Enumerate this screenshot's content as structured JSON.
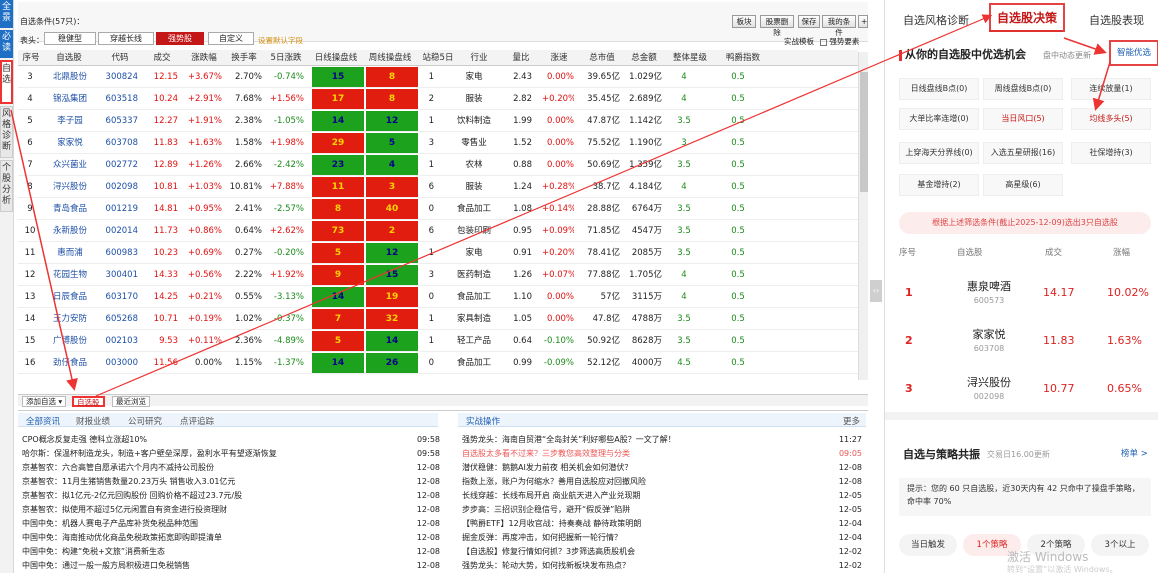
{
  "sidebar": [
    "全景",
    "必读",
    "自选",
    "风格诊断",
    "个股分析"
  ],
  "cond": {
    "title": "自选条件(57只)：",
    "label": "表头：",
    "tabs": [
      "稳健型",
      "穿越长线",
      "强势股",
      "自定义"
    ],
    "custom_link": "设置默认字段",
    "right_buttons": [
      "板块",
      "股票删除",
      "保存",
      "我的条件",
      "+"
    ],
    "realtime": "实战模板",
    "follow": "强势要素"
  },
  "columns": [
    "序号",
    "自选股",
    "代码",
    "成交",
    "涨跌幅",
    "换手率",
    "5日涨跌",
    "日线操盘线",
    "周线操盘线",
    "站稳5日",
    "行业",
    "量比",
    "涨速",
    "总市值",
    "总金额",
    "整体星级",
    "鸭爵指数"
  ],
  "rows": [
    {
      "n": "3",
      "name": "北鼎股份",
      "code": "300824",
      "p": "12.15",
      "chg": "+3.67%",
      "turn": "2.70%",
      "d5": "-0.74%",
      "day": "15",
      "week": "8",
      "dc": "g",
      "wc": "r",
      "st": "1",
      "ind": "家电",
      "vr": "2.43",
      "spd": "0.00%",
      "mv": "39.65亿",
      "amt": "1.029亿",
      "star": "4",
      "idx": "0.5"
    },
    {
      "n": "4",
      "name": "锦泓集团",
      "code": "603518",
      "p": "10.24",
      "chg": "+2.91%",
      "turn": "7.68%",
      "d5": "+1.56%",
      "day": "17",
      "week": "8",
      "dc": "r",
      "wc": "r",
      "st": "2",
      "ind": "服装",
      "vr": "2.82",
      "spd": "+0.20%",
      "mv": "35.45亿",
      "amt": "2.689亿",
      "star": "4",
      "idx": "0.5"
    },
    {
      "n": "5",
      "name": "李子园",
      "code": "605337",
      "p": "12.27",
      "chg": "+1.91%",
      "turn": "2.38%",
      "d5": "-1.05%",
      "day": "14",
      "week": "12",
      "dc": "g",
      "wc": "g",
      "st": "1",
      "ind": "饮料制造",
      "vr": "1.99",
      "spd": "0.00%",
      "mv": "47.87亿",
      "amt": "1.142亿",
      "star": "3.5",
      "idx": "0.5"
    },
    {
      "n": "6",
      "name": "家家悦",
      "code": "603708",
      "p": "11.83",
      "chg": "+1.63%",
      "turn": "1.58%",
      "d5": "+1.98%",
      "day": "29",
      "week": "5",
      "dc": "r",
      "wc": "g",
      "st": "3",
      "ind": "零售业",
      "vr": "1.52",
      "spd": "0.00%",
      "mv": "75.52亿",
      "amt": "1.190亿",
      "star": "3",
      "idx": "0.5"
    },
    {
      "n": "7",
      "name": "众兴菌业",
      "code": "002772",
      "p": "12.89",
      "chg": "+1.26%",
      "turn": "2.66%",
      "d5": "-2.42%",
      "day": "23",
      "week": "4",
      "dc": "g",
      "wc": "g",
      "st": "1",
      "ind": "农林",
      "vr": "0.88",
      "spd": "0.00%",
      "mv": "50.69亿",
      "amt": "1.359亿",
      "star": "3.5",
      "idx": "0.5"
    },
    {
      "n": "8",
      "name": "浔兴股份",
      "code": "002098",
      "p": "10.81",
      "chg": "+1.03%",
      "turn": "10.81%",
      "d5": "+7.88%",
      "day": "11",
      "week": "3",
      "dc": "r",
      "wc": "r",
      "st": "6",
      "ind": "服装",
      "vr": "1.24",
      "spd": "+0.28%",
      "mv": "38.7亿",
      "amt": "4.184亿",
      "star": "4",
      "idx": "0.5"
    },
    {
      "n": "9",
      "name": "青岛食品",
      "code": "001219",
      "p": "14.81",
      "chg": "+0.95%",
      "turn": "2.41%",
      "d5": "-2.57%",
      "day": "8",
      "week": "40",
      "dc": "r",
      "wc": "r",
      "st": "0",
      "ind": "食品加工",
      "vr": "1.08",
      "spd": "+0.14%",
      "mv": "28.88亿",
      "amt": "6764万",
      "star": "3.5",
      "idx": "0.5"
    },
    {
      "n": "10",
      "name": "永新股份",
      "code": "002014",
      "p": "11.73",
      "chg": "+0.86%",
      "turn": "0.64%",
      "d5": "+2.62%",
      "day": "73",
      "week": "2",
      "dc": "r",
      "wc": "r",
      "st": "6",
      "ind": "包装印刷",
      "vr": "0.95",
      "spd": "+0.09%",
      "mv": "71.85亿",
      "amt": "4547万",
      "star": "3.5",
      "idx": "0.5"
    },
    {
      "n": "11",
      "name": "惠而浦",
      "code": "600983",
      "p": "10.23",
      "chg": "+0.69%",
      "turn": "0.27%",
      "d5": "-0.20%",
      "day": "5",
      "week": "12",
      "dc": "r",
      "wc": "g",
      "st": "1",
      "ind": "家电",
      "vr": "0.91",
      "spd": "+0.20%",
      "mv": "78.41亿",
      "amt": "2085万",
      "star": "3.5",
      "idx": "0.5"
    },
    {
      "n": "12",
      "name": "花园生物",
      "code": "300401",
      "p": "14.33",
      "chg": "+0.56%",
      "turn": "2.22%",
      "d5": "+1.92%",
      "day": "9",
      "week": "15",
      "dc": "r",
      "wc": "g",
      "st": "3",
      "ind": "医药制造",
      "vr": "1.26",
      "spd": "+0.07%",
      "mv": "77.88亿",
      "amt": "1.705亿",
      "star": "4",
      "idx": "0.5"
    },
    {
      "n": "13",
      "name": "日辰食品",
      "code": "603170",
      "p": "14.25",
      "chg": "+0.21%",
      "turn": "0.55%",
      "d5": "-3.13%",
      "day": "14",
      "week": "19",
      "dc": "g",
      "wc": "r",
      "st": "0",
      "ind": "食品加工",
      "vr": "1.10",
      "spd": "0.00%",
      "mv": "57亿",
      "amt": "3115万",
      "star": "4",
      "idx": "0.5"
    },
    {
      "n": "14",
      "name": "王力安防",
      "code": "605268",
      "p": "10.71",
      "chg": "+0.19%",
      "turn": "1.02%",
      "d5": "-0.37%",
      "day": "7",
      "week": "32",
      "dc": "r",
      "wc": "r",
      "st": "1",
      "ind": "家具制造",
      "vr": "1.05",
      "spd": "0.00%",
      "mv": "47.8亿",
      "amt": "4788万",
      "star": "3.5",
      "idx": "0.5"
    },
    {
      "n": "15",
      "name": "广博股份",
      "code": "002103",
      "p": "9.53",
      "chg": "+0.11%",
      "turn": "2.36%",
      "d5": "-4.89%",
      "day": "5",
      "week": "14",
      "dc": "r",
      "wc": "g",
      "st": "1",
      "ind": "轻工产品",
      "vr": "0.64",
      "spd": "-0.10%",
      "mv": "50.92亿",
      "amt": "8628万",
      "star": "3.5",
      "idx": "0.5"
    },
    {
      "n": "16",
      "name": "劲仔食品",
      "code": "003000",
      "p": "11.56",
      "chg": "0.00%",
      "turn": "1.15%",
      "d5": "-1.37%",
      "day": "14",
      "week": "26",
      "dc": "g",
      "wc": "g",
      "st": "0",
      "ind": "食品加工",
      "vr": "0.99",
      "spd": "-0.09%",
      "mv": "52.12亿",
      "amt": "4000万",
      "star": "4.5",
      "idx": "0.5"
    }
  ],
  "bottom_tabs": [
    "添加自选 ▾",
    "自选股",
    "最近浏览"
  ],
  "news_left_tabs": [
    "全部资讯",
    "财报业绩",
    "公司研究",
    "点评追踪"
  ],
  "news_right_tab": "实战操作",
  "news_more": "更多",
  "news_left": [
    {
      "t": "CPO概念反复走强 德科立涨超10%",
      "d": "09:58"
    },
    {
      "t": "哈尔斯：保温杯制造龙头，制造+客户壁垒深厚，盈利水平有望逐渐恢复",
      "d": "09:58"
    },
    {
      "t": "京基智农：六合高管自愿承诺六个月内不减持公司股份",
      "d": "12-08"
    },
    {
      "t": "京基智农：11月生猪销售数量20.23万头 销售收入3.01亿元",
      "d": "12-08"
    },
    {
      "t": "京基智农：拟1亿元-2亿元回购股份 回购价格不超过23.7元/股",
      "d": "12-08"
    },
    {
      "t": "京基智农：拟使用不超过5亿元闲置自有资金进行投资理财",
      "d": "12-08"
    },
    {
      "t": "中国中免：机器人赛电子产品库补货免税品种范围",
      "d": "12-08"
    },
    {
      "t": "中国中免：海南推动优化商品免税政策拓宽即购即提清单",
      "d": "12-08"
    },
    {
      "t": "中国中免：构建“免税+文旅”消费新生态",
      "d": "12-08"
    },
    {
      "t": "中国中免：通过一般一般方局积极进口免税销售",
      "d": "12-08"
    }
  ],
  "news_right": [
    {
      "t": "强势龙头：海南自贸港“全岛封关”利好哪些A股？一文了解！",
      "d": "11:27"
    },
    {
      "t": "自选股太多看不过来？三步教您高效整理与分类",
      "d": "09:05"
    },
    {
      "t": "潜伏稳健：鹅鹅AI发力前夜 相关机会如何潜伏？",
      "d": "12-08"
    },
    {
      "t": "指数上涨，账户为何缩水？善用自选股应对回撤风险",
      "d": "12-08"
    },
    {
      "t": "长线穿越：长线布局开启 商业航天进入产业兑现期",
      "d": "12-05"
    },
    {
      "t": "步步高：三招识别企稳信号，避开“假反弹”陷阱",
      "d": "12-05"
    },
    {
      "t": "【鸭爵ETF】12月收官战：持奏奏战 静待政策明朗",
      "d": "12-04"
    },
    {
      "t": "掘金反弹：再度冲击，如何把握新一轮行情？",
      "d": "12-04"
    },
    {
      "t": "【自选股】修复行情如何抓？3步筛选高质股机会",
      "d": "12-02"
    },
    {
      "t": "强势龙头：轮动大势，如何找新板块发布热点？",
      "d": "12-02"
    }
  ],
  "right": {
    "tabs": [
      "自选风格诊断",
      "自选股决策",
      "自选股表现"
    ],
    "heading": "从你的自选股中优选机会",
    "sub": "盘中动态更新",
    "smart": "智能优选",
    "tags": [
      "日线盘线B点(0)",
      "周线盘线B点(0)",
      "连续放量(1)",
      "大单比率连增(0)",
      "当日风口(5)",
      "均线多头(5)",
      "上穿海天分界线(0)",
      "入选五星研报(16)",
      "社保增持(3)",
      "基金增持(2)",
      "高星级(6)"
    ],
    "notice": "根据上述筛选条件(截止2025-12-09)选出3只自选股",
    "cols": [
      "序号",
      "自选股",
      "成交",
      "涨幅"
    ],
    "picks": [
      {
        "n": "1",
        "name": "惠泉啤酒",
        "code": "600573",
        "p": "14.17",
        "chg": "10.02%"
      },
      {
        "n": "2",
        "name": "家家悦",
        "code": "603708",
        "p": "11.83",
        "chg": "1.63%"
      },
      {
        "n": "3",
        "name": "浔兴股份",
        "code": "002098",
        "p": "10.77",
        "chg": "0.65%"
      }
    ],
    "strategy_title": "自选与策略共振",
    "strategy_time": "交易日16.00更新",
    "strategy_link": "榜单 >",
    "tip": "提示：您的 60 只自选股，近30天内有 42 只命中了操盘手策略，命中率 70%",
    "pills": [
      "当日触发",
      "1个策略",
      "2个策略",
      "3个以上"
    ],
    "watermark": "激活 Windows",
    "watermark2": "转到“设置”以激活 Windows。"
  }
}
